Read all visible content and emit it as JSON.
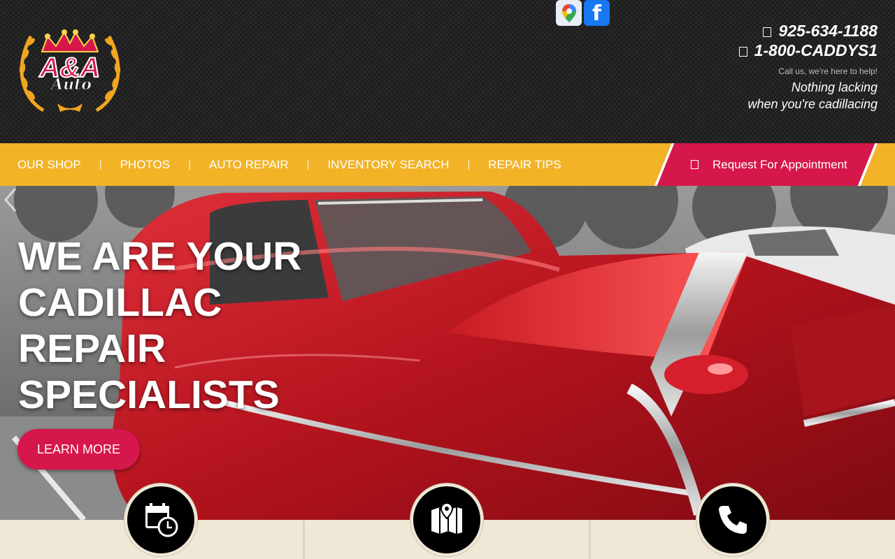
{
  "brand": {
    "logo_text": "A&A Auto",
    "colors": {
      "accent_yellow": "#f2b327",
      "accent_red": "#d6174b",
      "header_bg": "#232323"
    }
  },
  "social": [
    {
      "name": "google-maps-icon"
    },
    {
      "name": "facebook-icon",
      "glyph": "f"
    }
  ],
  "contact": {
    "phone1": "925-634-1188",
    "phone2": "1-800-CADDYS1",
    "help_text": "Call us, we're here to help!",
    "tagline_line1": "Nothing lacking",
    "tagline_line2": "when you're cadillacing"
  },
  "nav": {
    "items": [
      {
        "label": "OUR SHOP"
      },
      {
        "label": "PHOTOS"
      },
      {
        "label": "AUTO REPAIR"
      },
      {
        "label": "INVENTORY SEARCH"
      },
      {
        "label": "REPAIR TIPS"
      }
    ],
    "appointment_label": "Request For Appointment"
  },
  "hero": {
    "title": "WE ARE YOUR CADILLAC REPAIR SPECIALISTS",
    "button_label": "LEARN MORE"
  },
  "features": [
    {
      "icon": "calendar-clock-icon"
    },
    {
      "icon": "map-icon"
    },
    {
      "icon": "phone-icon"
    }
  ]
}
